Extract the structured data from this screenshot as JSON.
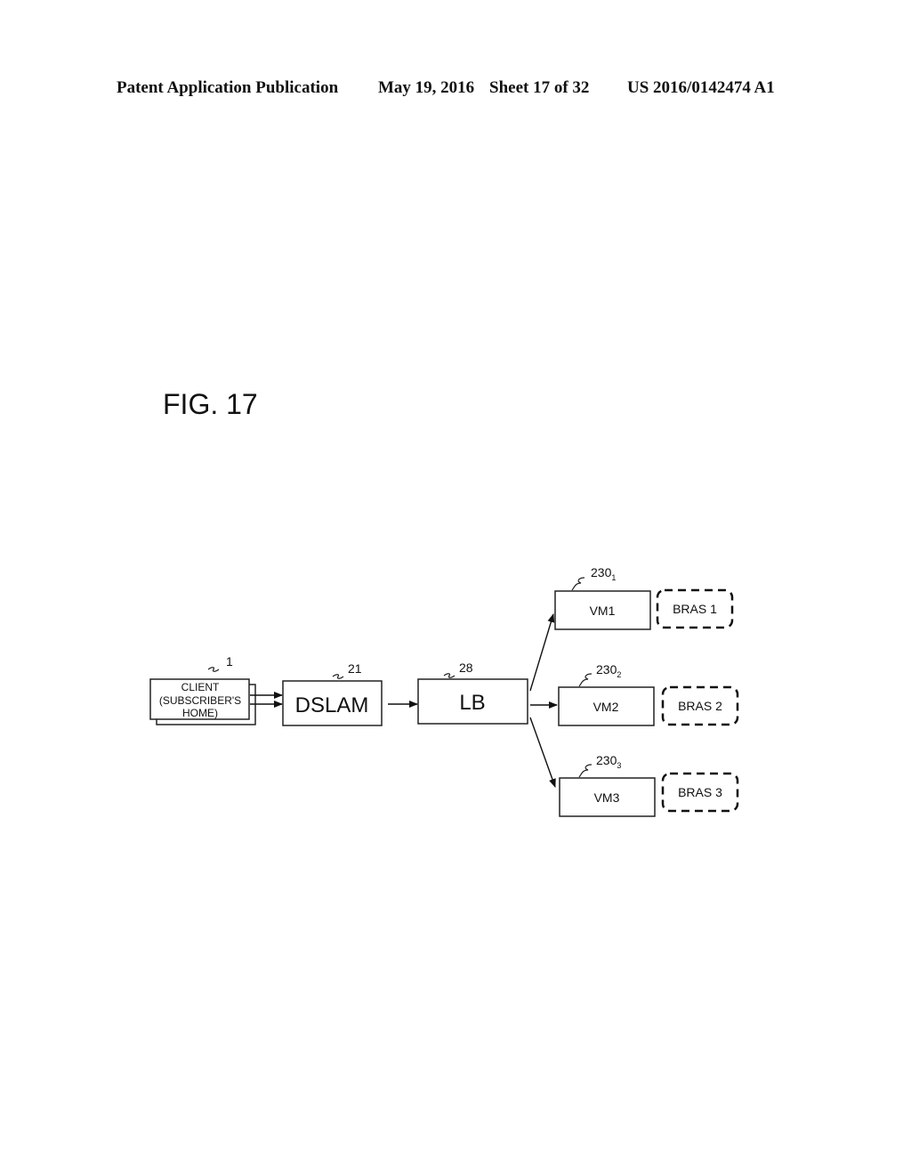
{
  "header": {
    "left": "Patent Application Publication",
    "date": "May 19, 2016",
    "sheet": "Sheet 17 of 32",
    "pub_number": "US 2016/0142474 A1"
  },
  "figure": {
    "title": "FIG. 17"
  },
  "diagram": {
    "client": {
      "lines": [
        "CLIENT",
        "(SUBSCRIBER'S",
        "HOME)"
      ],
      "ref": "1"
    },
    "dslam": {
      "label": "DSLAM",
      "ref": "21"
    },
    "lb": {
      "label": "LB",
      "ref": "28"
    },
    "vms": [
      {
        "label": "VM1",
        "ref": "230",
        "ref_sub": "1",
        "bras": "BRAS 1"
      },
      {
        "label": "VM2",
        "ref": "230",
        "ref_sub": "2",
        "bras": "BRAS 2"
      },
      {
        "label": "VM3",
        "ref": "230",
        "ref_sub": "3",
        "bras": "BRAS 3"
      }
    ]
  }
}
